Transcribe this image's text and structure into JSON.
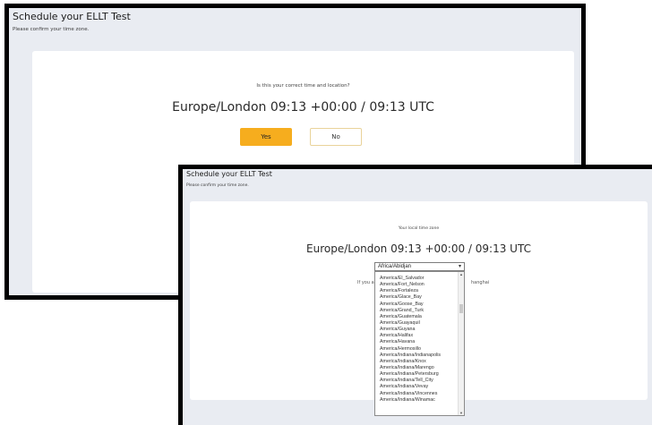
{
  "screenshot_a": {
    "title": "Schedule your ELLT Test",
    "subtitle": "Please confirm your time zone.",
    "question": "Is this your correct time and location?",
    "timezone_display": "Europe/London 09:13 +00:00 / 09:13 UTC",
    "yes_label": "Yes",
    "no_label": "No",
    "colors": {
      "primary_button": "#f6ad1e",
      "page_bg": "#e9ecf2",
      "card_bg": "#ffffff"
    }
  },
  "screenshot_b": {
    "title": "Schedule your ELLT Test",
    "subtitle": "Please confirm your time zone.",
    "prompt": "Your local time zone",
    "timezone_display": "Europe/London 09:13 +00:00 / 09:13 UTC",
    "select_value": "Africa/Abidjan",
    "helper_left": "If you ar",
    "helper_right": "hanghai",
    "dropdown_options": [
      "America/El_Salvador",
      "America/Fort_Nelson",
      "America/Fortaleza",
      "America/Glace_Bay",
      "America/Goose_Bay",
      "America/Grand_Turk",
      "America/Guatemala",
      "America/Guayaquil",
      "America/Guyana",
      "America/Halifax",
      "America/Havana",
      "America/Hermosillo",
      "America/Indiana/Indianapolis",
      "America/Indiana/Knox",
      "America/Indiana/Marengo",
      "America/Indiana/Petersburg",
      "America/Indiana/Tell_City",
      "America/Indiana/Vevay",
      "America/Indiana/Vincennes",
      "America/Indiana/Winamac"
    ]
  }
}
